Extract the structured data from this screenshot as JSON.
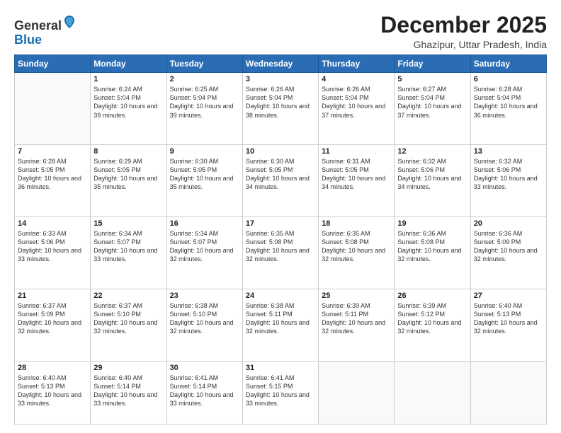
{
  "header": {
    "logo_general": "General",
    "logo_blue": "Blue",
    "month": "December 2025",
    "location": "Ghazipur, Uttar Pradesh, India"
  },
  "days_of_week": [
    "Sunday",
    "Monday",
    "Tuesday",
    "Wednesday",
    "Thursday",
    "Friday",
    "Saturday"
  ],
  "weeks": [
    [
      {
        "day": "",
        "text": ""
      },
      {
        "day": "1",
        "text": "Sunrise: 6:24 AM\nSunset: 5:04 PM\nDaylight: 10 hours and 39 minutes."
      },
      {
        "day": "2",
        "text": "Sunrise: 6:25 AM\nSunset: 5:04 PM\nDaylight: 10 hours and 39 minutes."
      },
      {
        "day": "3",
        "text": "Sunrise: 6:26 AM\nSunset: 5:04 PM\nDaylight: 10 hours and 38 minutes."
      },
      {
        "day": "4",
        "text": "Sunrise: 6:26 AM\nSunset: 5:04 PM\nDaylight: 10 hours and 37 minutes."
      },
      {
        "day": "5",
        "text": "Sunrise: 6:27 AM\nSunset: 5:04 PM\nDaylight: 10 hours and 37 minutes."
      },
      {
        "day": "6",
        "text": "Sunrise: 6:28 AM\nSunset: 5:04 PM\nDaylight: 10 hours and 36 minutes."
      }
    ],
    [
      {
        "day": "7",
        "text": "Sunrise: 6:28 AM\nSunset: 5:05 PM\nDaylight: 10 hours and 36 minutes."
      },
      {
        "day": "8",
        "text": "Sunrise: 6:29 AM\nSunset: 5:05 PM\nDaylight: 10 hours and 35 minutes."
      },
      {
        "day": "9",
        "text": "Sunrise: 6:30 AM\nSunset: 5:05 PM\nDaylight: 10 hours and 35 minutes."
      },
      {
        "day": "10",
        "text": "Sunrise: 6:30 AM\nSunset: 5:05 PM\nDaylight: 10 hours and 34 minutes."
      },
      {
        "day": "11",
        "text": "Sunrise: 6:31 AM\nSunset: 5:05 PM\nDaylight: 10 hours and 34 minutes."
      },
      {
        "day": "12",
        "text": "Sunrise: 6:32 AM\nSunset: 5:06 PM\nDaylight: 10 hours and 34 minutes."
      },
      {
        "day": "13",
        "text": "Sunrise: 6:32 AM\nSunset: 5:06 PM\nDaylight: 10 hours and 33 minutes."
      }
    ],
    [
      {
        "day": "14",
        "text": "Sunrise: 6:33 AM\nSunset: 5:06 PM\nDaylight: 10 hours and 33 minutes."
      },
      {
        "day": "15",
        "text": "Sunrise: 6:34 AM\nSunset: 5:07 PM\nDaylight: 10 hours and 33 minutes."
      },
      {
        "day": "16",
        "text": "Sunrise: 6:34 AM\nSunset: 5:07 PM\nDaylight: 10 hours and 32 minutes."
      },
      {
        "day": "17",
        "text": "Sunrise: 6:35 AM\nSunset: 5:08 PM\nDaylight: 10 hours and 32 minutes."
      },
      {
        "day": "18",
        "text": "Sunrise: 6:35 AM\nSunset: 5:08 PM\nDaylight: 10 hours and 32 minutes."
      },
      {
        "day": "19",
        "text": "Sunrise: 6:36 AM\nSunset: 5:08 PM\nDaylight: 10 hours and 32 minutes."
      },
      {
        "day": "20",
        "text": "Sunrise: 6:36 AM\nSunset: 5:09 PM\nDaylight: 10 hours and 32 minutes."
      }
    ],
    [
      {
        "day": "21",
        "text": "Sunrise: 6:37 AM\nSunset: 5:09 PM\nDaylight: 10 hours and 32 minutes."
      },
      {
        "day": "22",
        "text": "Sunrise: 6:37 AM\nSunset: 5:10 PM\nDaylight: 10 hours and 32 minutes."
      },
      {
        "day": "23",
        "text": "Sunrise: 6:38 AM\nSunset: 5:10 PM\nDaylight: 10 hours and 32 minutes."
      },
      {
        "day": "24",
        "text": "Sunrise: 6:38 AM\nSunset: 5:11 PM\nDaylight: 10 hours and 32 minutes."
      },
      {
        "day": "25",
        "text": "Sunrise: 6:39 AM\nSunset: 5:11 PM\nDaylight: 10 hours and 32 minutes."
      },
      {
        "day": "26",
        "text": "Sunrise: 6:39 AM\nSunset: 5:12 PM\nDaylight: 10 hours and 32 minutes."
      },
      {
        "day": "27",
        "text": "Sunrise: 6:40 AM\nSunset: 5:13 PM\nDaylight: 10 hours and 32 minutes."
      }
    ],
    [
      {
        "day": "28",
        "text": "Sunrise: 6:40 AM\nSunset: 5:13 PM\nDaylight: 10 hours and 33 minutes."
      },
      {
        "day": "29",
        "text": "Sunrise: 6:40 AM\nSunset: 5:14 PM\nDaylight: 10 hours and 33 minutes."
      },
      {
        "day": "30",
        "text": "Sunrise: 6:41 AM\nSunset: 5:14 PM\nDaylight: 10 hours and 33 minutes."
      },
      {
        "day": "31",
        "text": "Sunrise: 6:41 AM\nSunset: 5:15 PM\nDaylight: 10 hours and 33 minutes."
      },
      {
        "day": "",
        "text": ""
      },
      {
        "day": "",
        "text": ""
      },
      {
        "day": "",
        "text": ""
      }
    ]
  ]
}
